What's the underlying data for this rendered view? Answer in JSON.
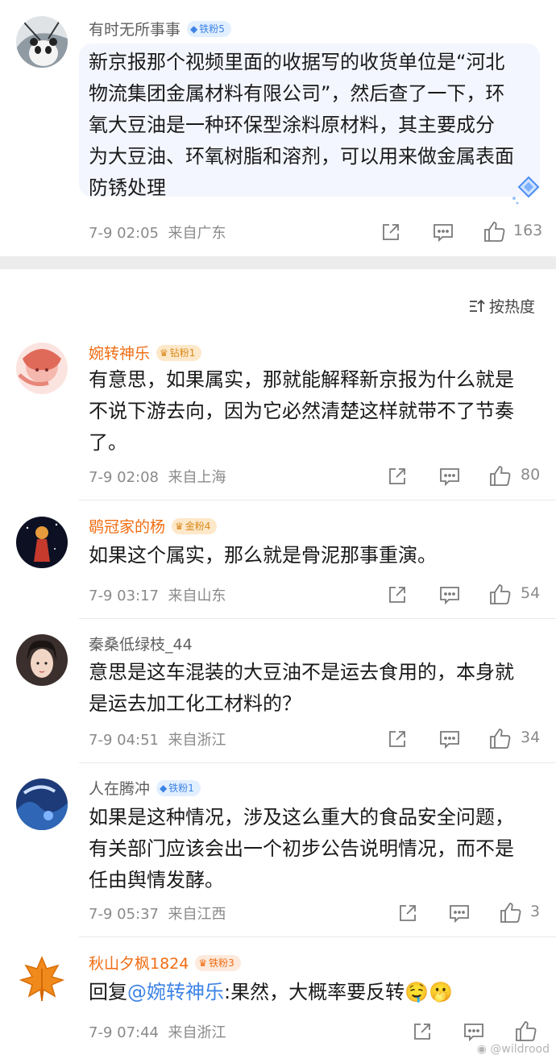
{
  "top_comment": {
    "username": "有时无所事事",
    "badge": "铁粉5",
    "text_lines": [
      "新京报那个视频里面的收据写的收货单位是“河北",
      "物流集团金属材料有限公司”，然后查了一下，环",
      "氧大豆油是一种环保型涂料原材料，其主要成分",
      "为大豆油、环氧树脂和溶剂，可以用来做金属表面",
      "防锈处理"
    ],
    "time": "7-9 02:05",
    "location": "来自广东",
    "likes": "163"
  },
  "sort_label": "按热度",
  "sort_icon": "sort-icon",
  "comments": [
    {
      "username": "婉转神乐",
      "badge": "钻粉1",
      "text_lines": [
        "有意思，如果属实，那就能解释新京报为什么就是",
        "不说下游去向，因为它必然清楚这样就带不了节奏",
        "了。"
      ],
      "time": "7-9 02:08",
      "location": "来自上海",
      "likes": "80"
    },
    {
      "username": "鹖冠家的杨",
      "badge": "金粉4",
      "text_lines": [
        "如果这个属实，那么就是骨泥那事重演。"
      ],
      "time": "7-9 03:17",
      "location": "来自山东",
      "likes": "54"
    },
    {
      "username": "秦桑低绿枝_44",
      "badge": "",
      "text_lines": [
        "意思是这车混装的大豆油不是运去食用的，本身就",
        "是运去加工化工材料的？"
      ],
      "time": "7-9 04:51",
      "location": "来自浙江",
      "likes": "34"
    },
    {
      "username": "人在腾冲",
      "badge": "铁粉1",
      "text_lines": [
        "如果是这种情况，涉及这么重大的食品安全问题，",
        "有关部门应该会出一个初步公告说明情况，而不是",
        "任由舆情发酵。"
      ],
      "time": "7-9 05:37",
      "location": "来自江西",
      "likes": "3"
    },
    {
      "username": "秋山夕枫1824",
      "badge": "铁粉3",
      "reply_prefix": "回复",
      "mention": "@婉转神乐",
      "reply_text": ":果然，大概率要反转",
      "emoji": "🤤🫢",
      "time": "7-9 07:44",
      "location": "来自浙江",
      "likes": ""
    }
  ],
  "watermark": "@wildrood",
  "icons": {
    "share": "share-icon",
    "comment": "comment-icon",
    "like": "thumbs-up-icon"
  },
  "colors": {
    "accent_blue": "#3d83e6",
    "orange_name": "#f06d13",
    "meta_gray": "#8a8a8a",
    "bubble": "#f4f6ff"
  }
}
